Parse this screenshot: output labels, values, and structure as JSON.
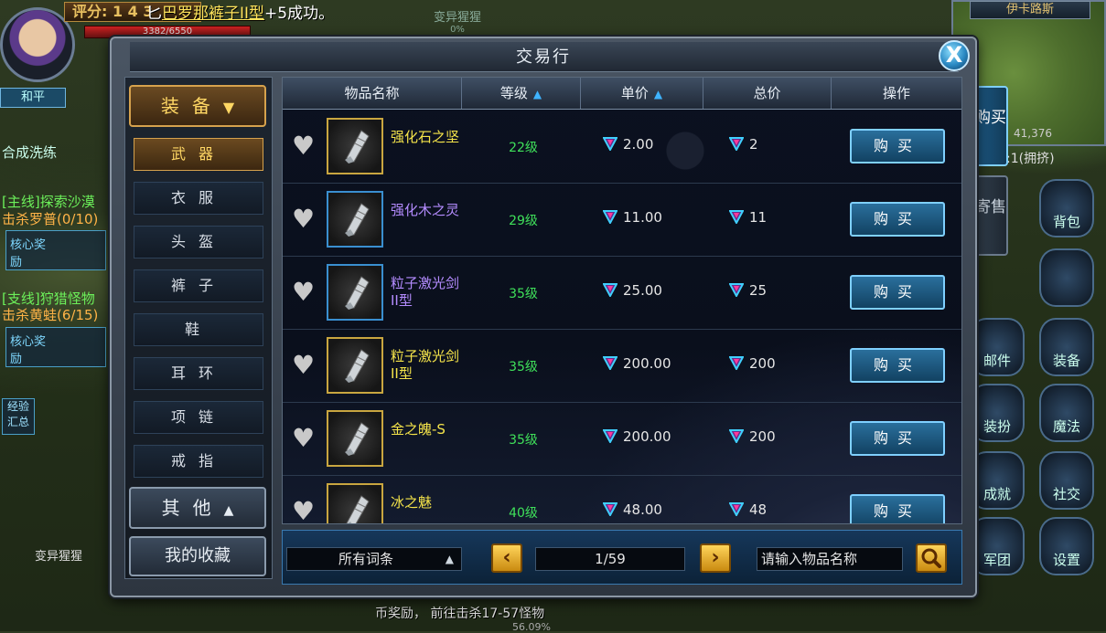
{
  "hud": {
    "top_message_prefix": "匕",
    "top_message_item": "巴罗那裤子II型",
    "top_message_suffix": "+5成功。",
    "score_label": "评分: 1 4 3",
    "hp_text": "3382/6550",
    "mutant_top": "变异猩猩",
    "mutant_top_pct": "0%",
    "peace_mode": "和平",
    "synthesis": "合成洗练",
    "quest1_title": "[主线]探索沙漠",
    "quest1_task": "击杀罗普(0/10)",
    "quest2_title": "[支线]狩猎怪物",
    "quest2_task": "击杀黄蛙(6/15)",
    "core_reward": "核心奖励",
    "exp_summary": "经验汇总",
    "mutant_bottom": "变异猩猩",
    "bottom_message": "币奖励，  前往击杀17-57怪物",
    "bottom_pct": "56.09%",
    "minimap_title": "伊卡路斯",
    "coords": "41,376",
    "line_info": ":1(拥挤)",
    "buttons": {
      "bag": "背包",
      "mail": "邮件",
      "equip": "装备",
      "outfit": "装扮",
      "magic": "魔法",
      "achievement": "成就",
      "social": "社交",
      "legion": "军团",
      "settings": "设置"
    }
  },
  "dialog": {
    "title": "交易行",
    "close_label": "X"
  },
  "categories": {
    "head": "装备",
    "items": [
      "武器",
      "衣服",
      "头盔",
      "裤子",
      "鞋",
      "耳环",
      "项链",
      "戒指"
    ],
    "other": "其他",
    "favorites": "我的收藏"
  },
  "table": {
    "headers": [
      "物品名称",
      "等级",
      "单价",
      "总价",
      "操作"
    ],
    "buy_label": "购买",
    "rows": [
      {
        "name": "强化石之坚",
        "name_color": "yellow",
        "frame": "gold",
        "level": "22级",
        "unit_price": "2.00",
        "total_price": "2"
      },
      {
        "name": "强化木之灵",
        "name_color": "purple",
        "frame": "blue",
        "level": "29级",
        "unit_price": "11.00",
        "total_price": "11"
      },
      {
        "name": "粒子激光剑II型",
        "name_color": "purple",
        "frame": "blue",
        "level": "35级",
        "unit_price": "25.00",
        "total_price": "25"
      },
      {
        "name": "粒子激光剑II型",
        "name_color": "yellow",
        "frame": "gold",
        "level": "35级",
        "unit_price": "200.00",
        "total_price": "200"
      },
      {
        "name": "金之魄-S",
        "name_color": "yellow",
        "frame": "gold",
        "level": "35级",
        "unit_price": "200.00",
        "total_price": "200"
      },
      {
        "name": "冰之魅",
        "name_color": "yellow",
        "frame": "gold",
        "level": "40级",
        "unit_price": "48.00",
        "total_price": "48"
      }
    ]
  },
  "toolbar": {
    "filter_value": "所有词条",
    "page": "1/59",
    "search_placeholder": "请输入物品名称"
  },
  "side_tabs": {
    "buy": "购买",
    "sell": "寄售"
  },
  "colors": {
    "accent_gold": "#ffd764",
    "accent_blue": "#7fd0ff",
    "level_green": "#3fe05a"
  }
}
